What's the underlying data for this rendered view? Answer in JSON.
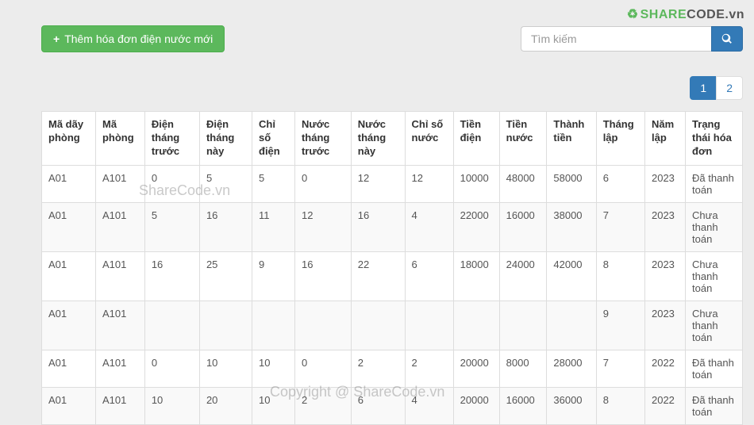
{
  "logo": {
    "text1": "SHARE",
    "text2": "CODE",
    "suffix": ".vn"
  },
  "toolbar": {
    "add_label": "Thêm hóa đơn điện nước mới",
    "search_placeholder": "Tìm kiếm"
  },
  "pagination": {
    "pages": [
      "1",
      "2"
    ],
    "active": 0
  },
  "watermarks": {
    "w1": "ShareCode.vn",
    "w2": "Copyright @ ShareCode.vn"
  },
  "table": {
    "headers": [
      "Mã dãy phòng",
      "Mã phòng",
      "Điện tháng trước",
      "Điện tháng này",
      "Chỉ số điện",
      "Nước tháng trước",
      "Nước tháng này",
      "Chỉ số nước",
      "Tiền điện",
      "Tiền nước",
      "Thành tiền",
      "Tháng lập",
      "Năm lập",
      "Trạng thái hóa đơn"
    ],
    "rows": [
      [
        "A01",
        "A101",
        "0",
        "5",
        "5",
        "0",
        "12",
        "12",
        "10000",
        "48000",
        "58000",
        "6",
        "2023",
        "Đã thanh toán"
      ],
      [
        "A01",
        "A101",
        "5",
        "16",
        "11",
        "12",
        "16",
        "4",
        "22000",
        "16000",
        "38000",
        "7",
        "2023",
        "Chưa thanh toán"
      ],
      [
        "A01",
        "A101",
        "16",
        "25",
        "9",
        "16",
        "22",
        "6",
        "18000",
        "24000",
        "42000",
        "8",
        "2023",
        "Chưa thanh toán"
      ],
      [
        "A01",
        "A101",
        "",
        "",
        "",
        "",
        "",
        "",
        "",
        "",
        "",
        "9",
        "2023",
        "Chưa thanh toán"
      ],
      [
        "A01",
        "A101",
        "0",
        "10",
        "10",
        "0",
        "2",
        "2",
        "20000",
        "8000",
        "28000",
        "7",
        "2022",
        "Đã thanh toán"
      ],
      [
        "A01",
        "A101",
        "10",
        "20",
        "10",
        "2",
        "6",
        "4",
        "20000",
        "16000",
        "36000",
        "8",
        "2022",
        "Đã thanh toán"
      ]
    ]
  }
}
